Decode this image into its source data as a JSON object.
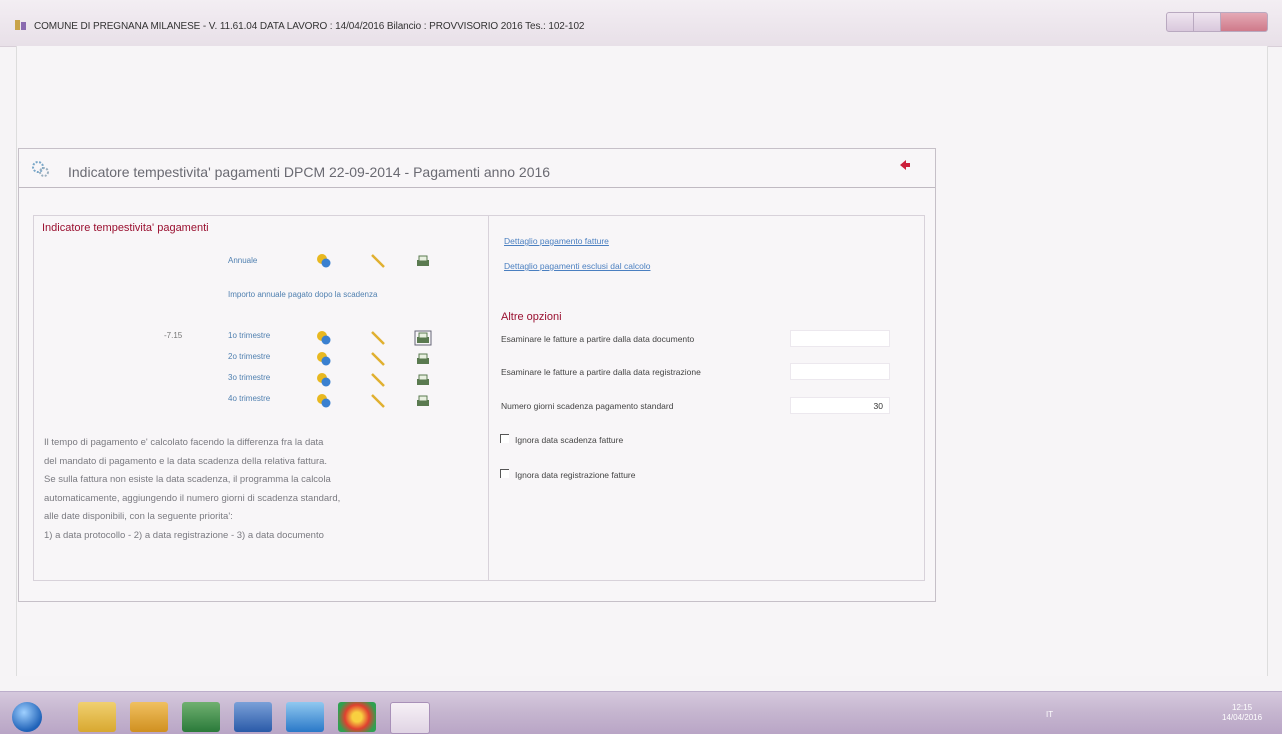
{
  "window": {
    "title": "COMUNE DI PREGNANA MILANESE - V. 11.61.04   DATA LAVORO : 14/04/2016   Bilancio : PROVVISORIO 2016   Tes.: 102-102"
  },
  "panel": {
    "title": "Indicatore tempestivita' pagamenti DPCM 22-09-2014 - Pagamenti anno  2016"
  },
  "left": {
    "section_title": "Indicatore tempestivita' pagamenti",
    "annual_label": "Annuale",
    "annual_amount_label": "Importo annuale pagato dopo la scadenza",
    "quarters": [
      {
        "value": "-7.15",
        "label": "1o trimestre"
      },
      {
        "value": "",
        "label": "2o trimestre"
      },
      {
        "value": "",
        "label": "3o trimestre"
      },
      {
        "value": "",
        "label": "4o trimestre"
      }
    ],
    "description": [
      "Il tempo di pagamento e' calcolato facendo la differenza fra la data",
      "del mandato di pagamento e la data scadenza della relativa fattura.",
      "Se sulla fattura non esiste la data scadenza, il programma la calcola",
      "automaticamente, aggiungendo il numero giorni di scadenza standard,",
      "alle date disponibili, con la seguente priorita':",
      "1) a data protocollo - 2) a data registrazione - 3) a data documento"
    ]
  },
  "right": {
    "link_details": "Dettaglio pagamento fatture",
    "link_excluded": "Dettaglio pagamenti esclusi dal calcolo",
    "options_title": "Altre opzioni",
    "opt_doc_date_label": "Esaminare le fatture a partire dalla data documento",
    "opt_doc_date_value": "",
    "opt_reg_date_label": "Esaminare le fatture a partire dalla data registrazione",
    "opt_reg_date_value": "",
    "opt_days_label": "Numero giorni scadenza pagamento standard",
    "opt_days_value": "30",
    "chk_ignore_due_label": "Ignora data scadenza fatture",
    "chk_ignore_reg_label": "Ignora data registrazione fatture"
  },
  "taskbar": {
    "lang": "IT",
    "time": "12:15",
    "date": "14/04/2016"
  },
  "colors": {
    "accent_red": "#9a1030",
    "link_blue": "#4a7fc0"
  }
}
